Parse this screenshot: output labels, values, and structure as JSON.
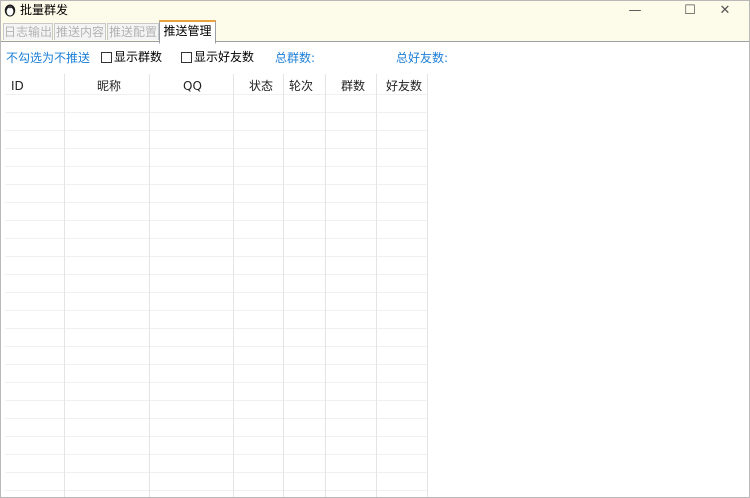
{
  "window": {
    "title": "批量群发"
  },
  "title_buttons": {
    "minimize": "—",
    "maximize": "☐",
    "close": "✕"
  },
  "tabs": [
    "日志输出",
    "推送内容",
    "推送配置",
    "推送管理"
  ],
  "toolbar": {
    "hint": "不勾选为不推送",
    "show_groups_label": "显示群数",
    "show_friends_label": "显示好友数",
    "total_groups_label": "总群数:",
    "total_friends_label": "总好友数:"
  },
  "table": {
    "columns": [
      "ID",
      "昵称",
      "QQ",
      "状态",
      "轮次",
      "群数",
      "好友数"
    ],
    "rows": []
  },
  "colors": {
    "accent_blue": "#1d7fd6",
    "active_tab_top": "#e8a33d",
    "title_bg": "#fdfbe9"
  }
}
